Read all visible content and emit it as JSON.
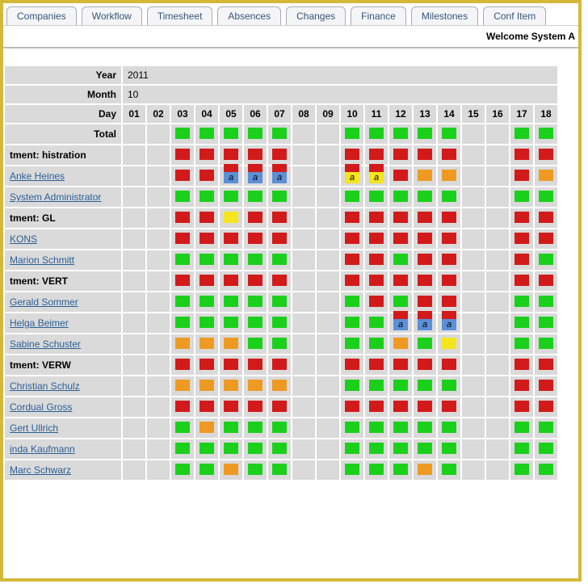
{
  "tabs": [
    "Companies",
    "Workflow",
    "Timesheet",
    "Absences",
    "Changes",
    "Finance",
    "Milestones",
    "Conf Item"
  ],
  "welcome": "Welcome System A",
  "header": {
    "year_label": "Year",
    "year_value": "2011",
    "month_label": "Month",
    "month_value": "10",
    "day_label": "Day",
    "total_label": "Total"
  },
  "days": [
    "01",
    "02",
    "03",
    "04",
    "05",
    "06",
    "07",
    "08",
    "09",
    "10",
    "11",
    "12",
    "13",
    "14",
    "15",
    "16",
    "17",
    "18"
  ],
  "legend_a": "a",
  "rows": [
    {
      "kind": "total",
      "label": "Total",
      "cells": [
        "",
        "",
        "g",
        "g",
        "g",
        "g",
        "g",
        "",
        "",
        "g",
        "g",
        "g",
        "g",
        "g",
        "",
        "",
        "g",
        "g"
      ]
    },
    {
      "kind": "dept",
      "label": "tment:\nhistration",
      "cells": [
        "",
        "",
        "r",
        "r",
        "r",
        "r",
        "r",
        "",
        "",
        "r",
        "r",
        "r",
        "r",
        "r",
        "",
        "",
        "r",
        "r"
      ]
    },
    {
      "kind": "user",
      "label": "Anke Heines",
      "cells": [
        "",
        "",
        "r",
        "r",
        "rb-a",
        "rb-a",
        "rb-a",
        "",
        "",
        "ry-a",
        "ry-a",
        "r",
        "o",
        "o",
        "",
        "",
        "r",
        "o"
      ]
    },
    {
      "kind": "user",
      "label": "System Administrator",
      "cells": [
        "",
        "",
        "g",
        "g",
        "g",
        "g",
        "g",
        "",
        "",
        "g",
        "g",
        "g",
        "g",
        "g",
        "",
        "",
        "g",
        "g"
      ]
    },
    {
      "kind": "dept",
      "label": "tment: GL",
      "cells": [
        "",
        "",
        "r",
        "r",
        "y",
        "r",
        "r",
        "",
        "",
        "r",
        "r",
        "r",
        "r",
        "r",
        "",
        "",
        "r",
        "r"
      ]
    },
    {
      "kind": "user",
      "label": "KONS",
      "cells": [
        "",
        "",
        "r",
        "r",
        "r",
        "r",
        "r",
        "",
        "",
        "r",
        "r",
        "r",
        "r",
        "r",
        "",
        "",
        "r",
        "r"
      ]
    },
    {
      "kind": "user",
      "label": "Marion Schmitt",
      "cells": [
        "",
        "",
        "g",
        "g",
        "g",
        "g",
        "g",
        "",
        "",
        "r",
        "r",
        "g",
        "r",
        "r",
        "",
        "",
        "r",
        "g"
      ]
    },
    {
      "kind": "dept",
      "label": "tment: VERT",
      "cells": [
        "",
        "",
        "r",
        "r",
        "r",
        "r",
        "r",
        "",
        "",
        "r",
        "r",
        "r",
        "r",
        "r",
        "",
        "",
        "r",
        "r"
      ]
    },
    {
      "kind": "user",
      "label": "Gerald Sommer",
      "cells": [
        "",
        "",
        "g",
        "g",
        "g",
        "g",
        "g",
        "",
        "",
        "g",
        "r",
        "g",
        "r",
        "r",
        "",
        "",
        "g",
        "g"
      ]
    },
    {
      "kind": "user",
      "label": "Helga Beimer",
      "cells": [
        "",
        "",
        "g",
        "g",
        "g",
        "g",
        "g",
        "",
        "",
        "g",
        "g",
        "rb-a",
        "rb-a",
        "rb-a",
        "",
        "",
        "g",
        "g"
      ]
    },
    {
      "kind": "user",
      "label": "Sabine Schuster",
      "cells": [
        "",
        "",
        "o",
        "o",
        "o",
        "g",
        "g",
        "",
        "",
        "g",
        "g",
        "o",
        "g",
        "y",
        "",
        "",
        "g",
        "g"
      ]
    },
    {
      "kind": "dept",
      "label": "tment: VERW",
      "cells": [
        "",
        "",
        "r",
        "r",
        "r",
        "r",
        "r",
        "",
        "",
        "r",
        "r",
        "r",
        "r",
        "r",
        "",
        "",
        "r",
        "r"
      ]
    },
    {
      "kind": "user",
      "label": "Christian Schulz",
      "cells": [
        "",
        "",
        "o",
        "o",
        "o",
        "o",
        "o",
        "",
        "",
        "g",
        "g",
        "g",
        "g",
        "g",
        "",
        "",
        "r",
        "r"
      ]
    },
    {
      "kind": "user",
      "label": "Cordual Gross",
      "cells": [
        "",
        "",
        "r",
        "r",
        "r",
        "r",
        "r",
        "",
        "",
        "r",
        "r",
        "r",
        "r",
        "r",
        "",
        "",
        "r",
        "r"
      ]
    },
    {
      "kind": "user",
      "label": "Gert Ullrich",
      "cells": [
        "",
        "",
        "g",
        "o",
        "g",
        "g",
        "g",
        "",
        "",
        "g",
        "g",
        "g",
        "g",
        "g",
        "",
        "",
        "g",
        "g"
      ]
    },
    {
      "kind": "user",
      "label": "inda Kaufmann",
      "cells": [
        "",
        "",
        "g",
        "g",
        "g",
        "g",
        "g",
        "",
        "",
        "g",
        "g",
        "g",
        "g",
        "g",
        "",
        "",
        "g",
        "g"
      ]
    },
    {
      "kind": "user",
      "label": "Marc Schwarz",
      "cells": [
        "",
        "",
        "g",
        "g",
        "o",
        "g",
        "g",
        "",
        "",
        "g",
        "g",
        "g",
        "o",
        "g",
        "",
        "",
        "g",
        "g"
      ]
    }
  ]
}
